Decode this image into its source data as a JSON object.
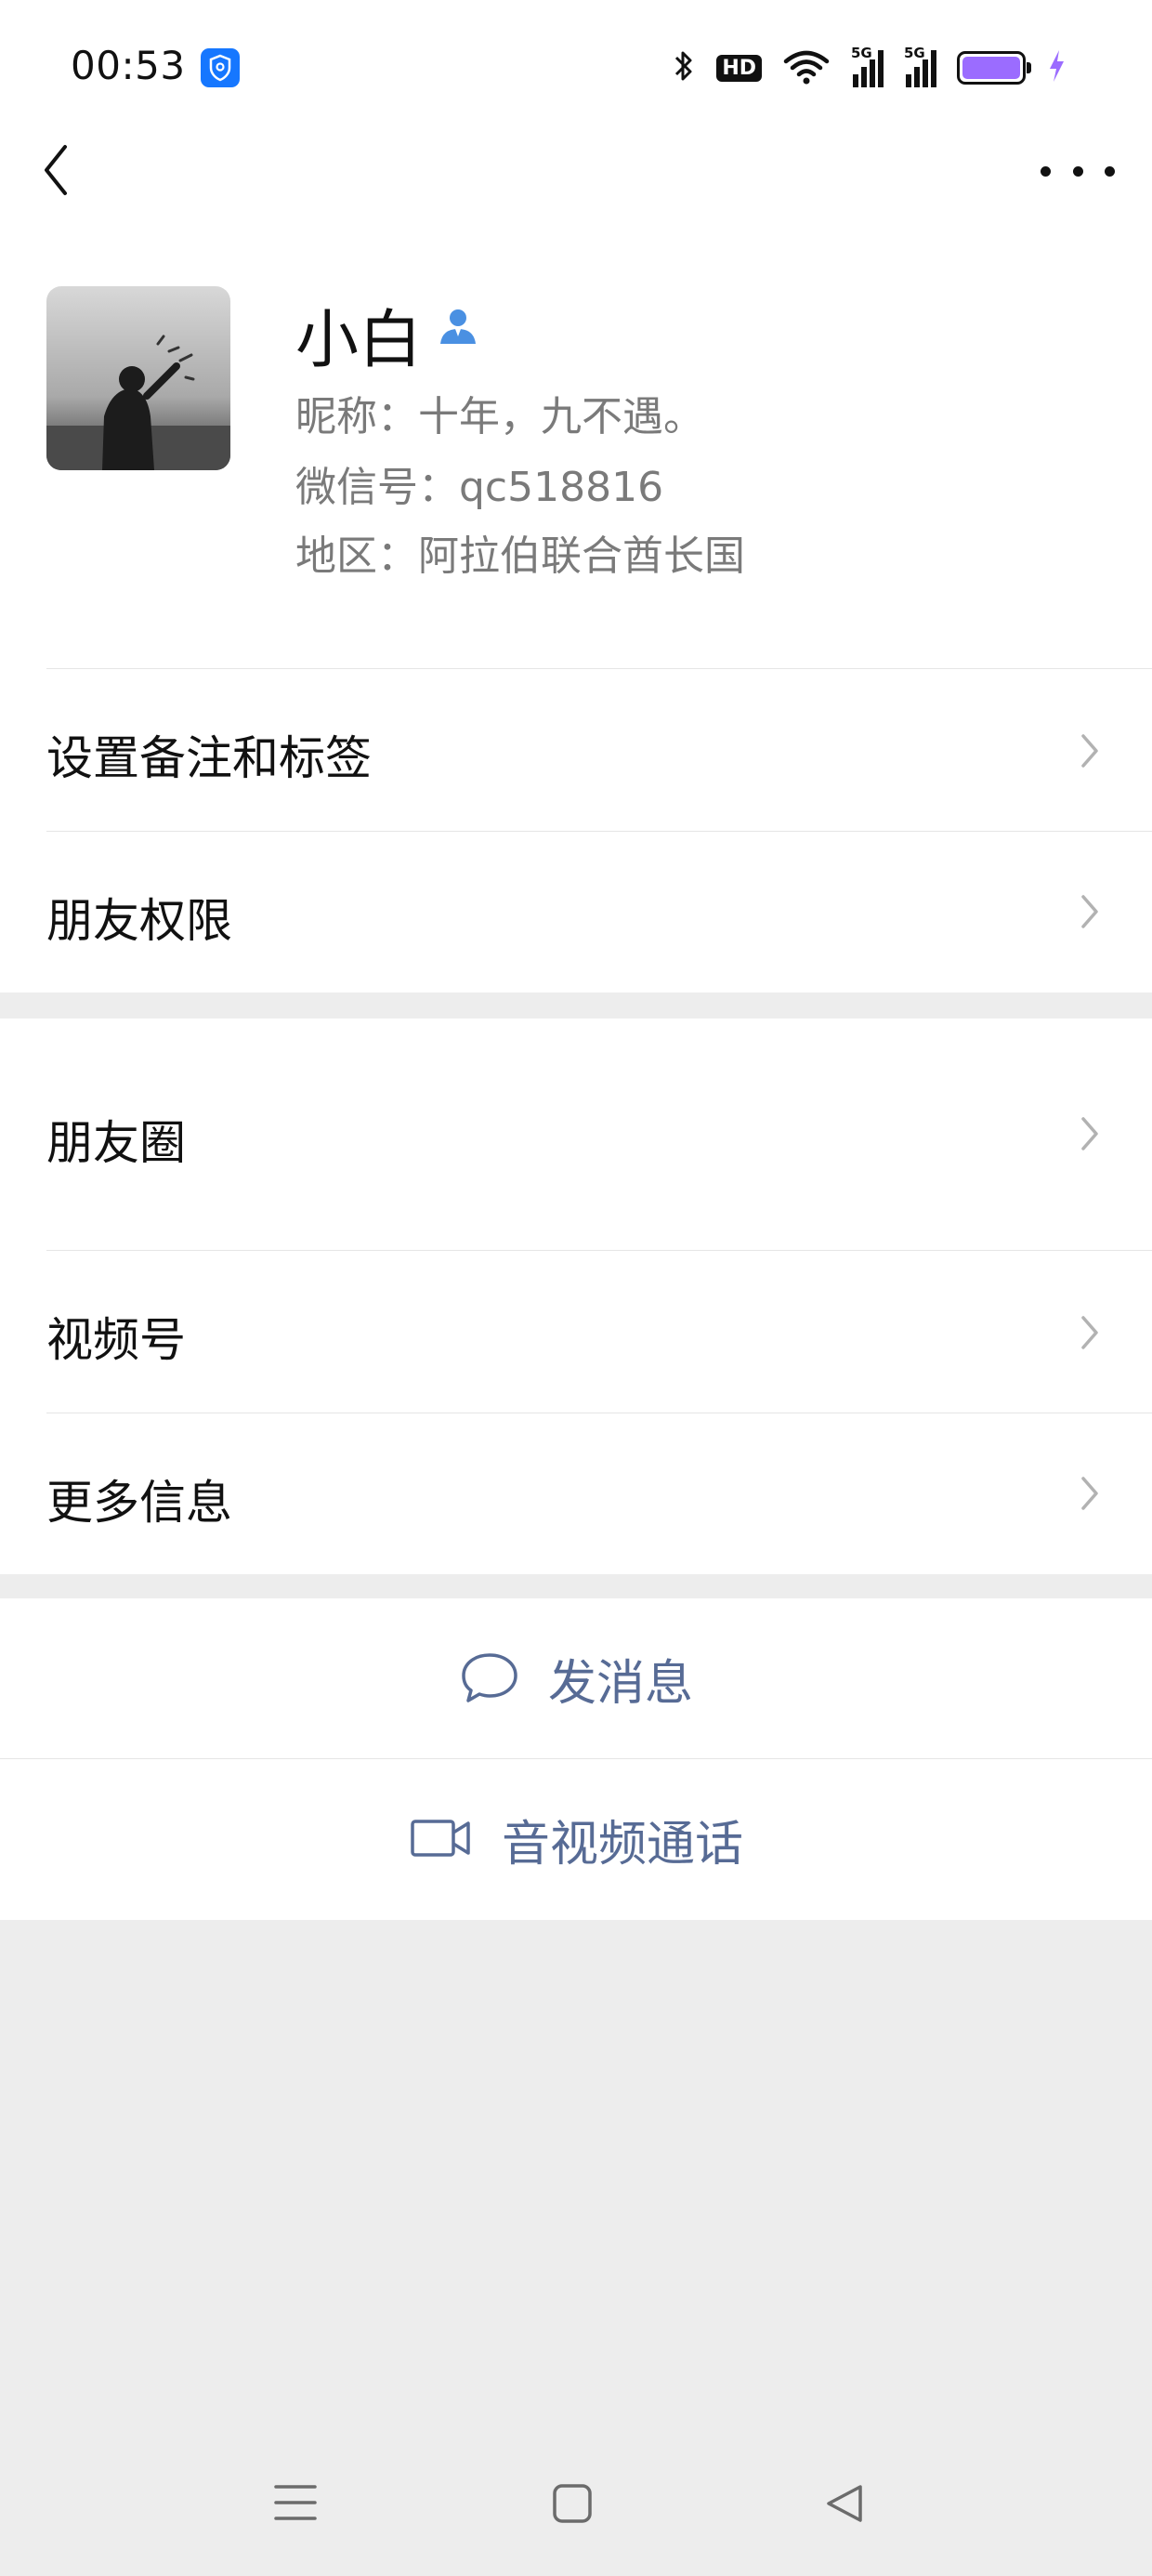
{
  "status_bar": {
    "time": "00:53",
    "shield_icon": "shield-icon",
    "hd_label": "HD",
    "network_label": "5G",
    "battery_color": "#9b6cff"
  },
  "profile": {
    "name": "小白",
    "nickname": "昵称：十年，九不遇。",
    "wechat_id": "微信号：qc518816",
    "region": "地区：阿拉伯联合酋长国"
  },
  "menu": {
    "remark_tags": "设置备注和标签",
    "friend_permissions": "朋友权限",
    "moments": "朋友圈",
    "channels": "视频号",
    "more_info": "更多信息"
  },
  "actions": {
    "send_message": "发消息",
    "av_call": "音视频通话",
    "accent_color": "#576b95"
  }
}
